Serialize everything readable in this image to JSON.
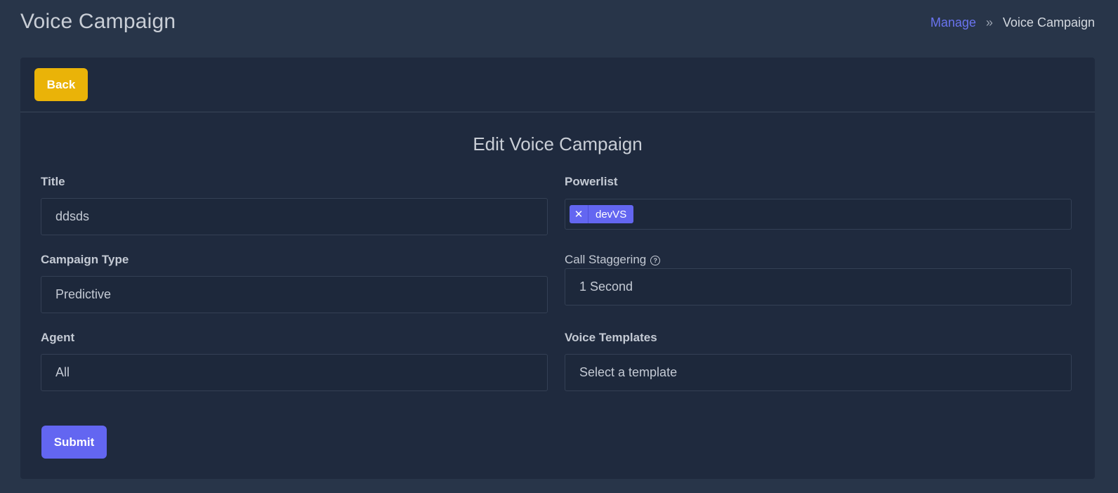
{
  "header": {
    "title": "Voice Campaign",
    "breadcrumb": {
      "link": "Manage",
      "separator": "»",
      "current": "Voice Campaign"
    }
  },
  "card": {
    "back_label": "Back",
    "form_title": "Edit Voice Campaign",
    "submit_label": "Submit"
  },
  "form": {
    "title": {
      "label": "Title",
      "value": "ddsds"
    },
    "powerlist": {
      "label": "Powerlist",
      "tags": [
        "devVS"
      ],
      "remove_glyph": "✕"
    },
    "campaign_type": {
      "label": "Campaign Type",
      "value": "Predictive"
    },
    "call_staggering": {
      "label": "Call Staggering",
      "value": "1 Second",
      "help_glyph": "?"
    },
    "agent": {
      "label": "Agent",
      "value": "All"
    },
    "voice_templates": {
      "label": "Voice Templates",
      "value": "Select a template"
    }
  },
  "icons": {
    "breadcrumb_separator": "chevron-double-right-icon",
    "tag_remove": "close-icon",
    "help": "question-circle-icon"
  },
  "colors": {
    "background": "#283549",
    "card": "#1f2a3e",
    "accent": "#6366f1",
    "back_button": "#eab308",
    "link": "#6a74f0"
  }
}
